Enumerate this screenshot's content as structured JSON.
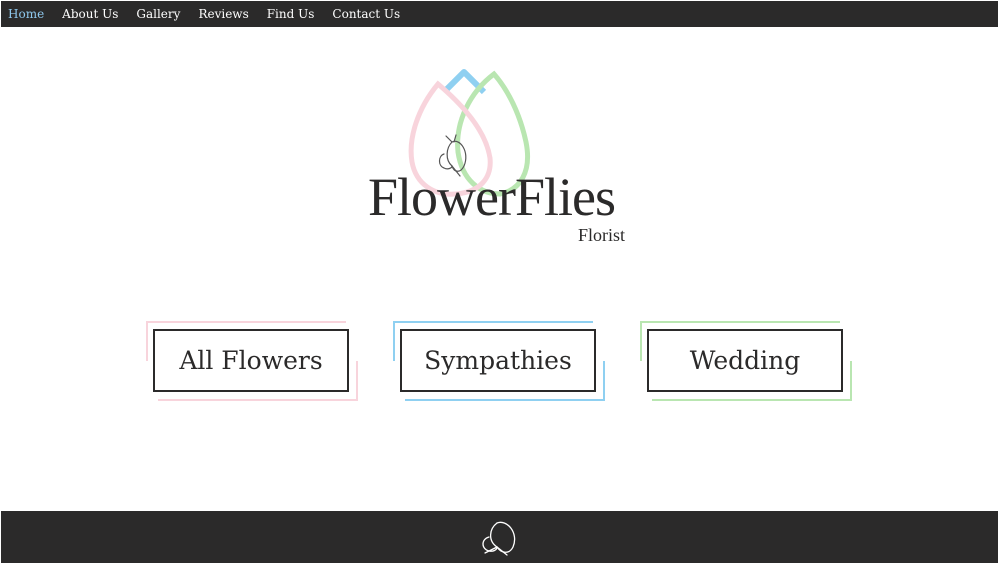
{
  "nav": {
    "items": [
      {
        "label": "Home",
        "active": true
      },
      {
        "label": "About Us",
        "active": false
      },
      {
        "label": "Gallery",
        "active": false
      },
      {
        "label": "Reviews",
        "active": false
      },
      {
        "label": "Find Us",
        "active": false
      },
      {
        "label": "Contact Us",
        "active": false
      }
    ],
    "active_color": "#8fc9ee",
    "background": "#2b2a2a"
  },
  "logo": {
    "brand": "FlowerFlies",
    "subtitle": "Florist",
    "icon": "butterfly-petals-icon",
    "petal_colors": [
      "#f8d4dc",
      "#8fd0f1",
      "#b9e6b1"
    ]
  },
  "categories": [
    {
      "label": "All Flowers",
      "accent": "#f8d4dc"
    },
    {
      "label": "Sympathies",
      "accent": "#8fd0f1"
    },
    {
      "label": "Wedding",
      "accent": "#b9e6b1"
    }
  ],
  "footer": {
    "icon": "butterfly-icon",
    "background": "#2b2a2a"
  }
}
